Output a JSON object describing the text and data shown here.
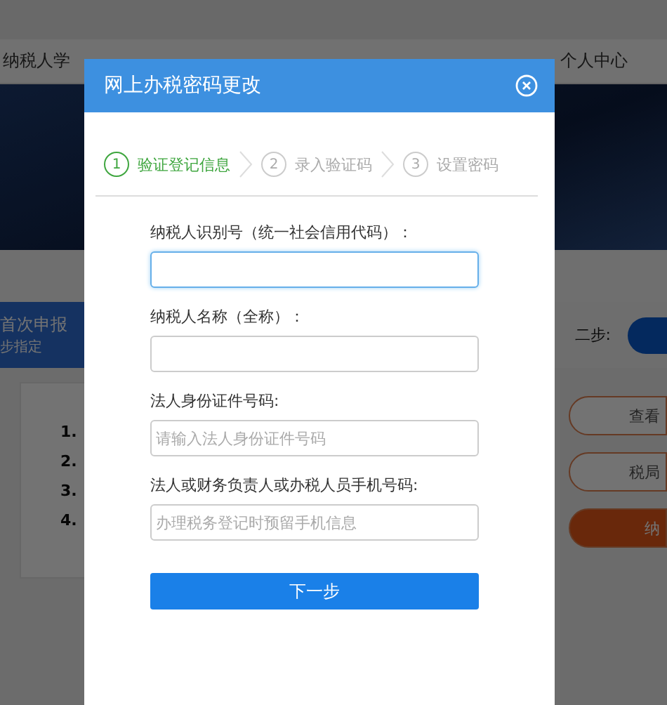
{
  "nav": [
    {
      "label": "纳税人学"
    },
    {
      "label": "个人中心"
    }
  ],
  "banner": {
    "title": "首次申报",
    "subtitle": "步指定",
    "right_text": "二步:"
  },
  "list_items": [
    "1.",
    "2.",
    "3.",
    "4."
  ],
  "side_buttons": [
    {
      "label": "查看",
      "kind": "outline"
    },
    {
      "label": "税局",
      "kind": "outline"
    },
    {
      "label": "纳",
      "kind": "filled"
    }
  ],
  "dialog": {
    "title": "网上办税密码更改",
    "steps": [
      {
        "number": "1",
        "label": "验证登记信息",
        "selected": true
      },
      {
        "number": "2",
        "label": "录入验证码",
        "selected": false
      },
      {
        "number": "3",
        "label": "设置密码",
        "selected": false
      }
    ],
    "fields": [
      {
        "label": "纳税人识别号（统一社会信用代码）：",
        "focused": true
      },
      {
        "label": "纳税人名称（全称）：",
        "focused": false
      },
      {
        "label": "法人身份证件号码:",
        "placeholder": "请输入法人身份证件号码",
        "focused": false
      },
      {
        "label": "法人或财务负责人或办税人员手机号码:",
        "placeholder": "办理税务登记时预留手机信息",
        "focused": false
      }
    ],
    "submit": "下一步"
  }
}
